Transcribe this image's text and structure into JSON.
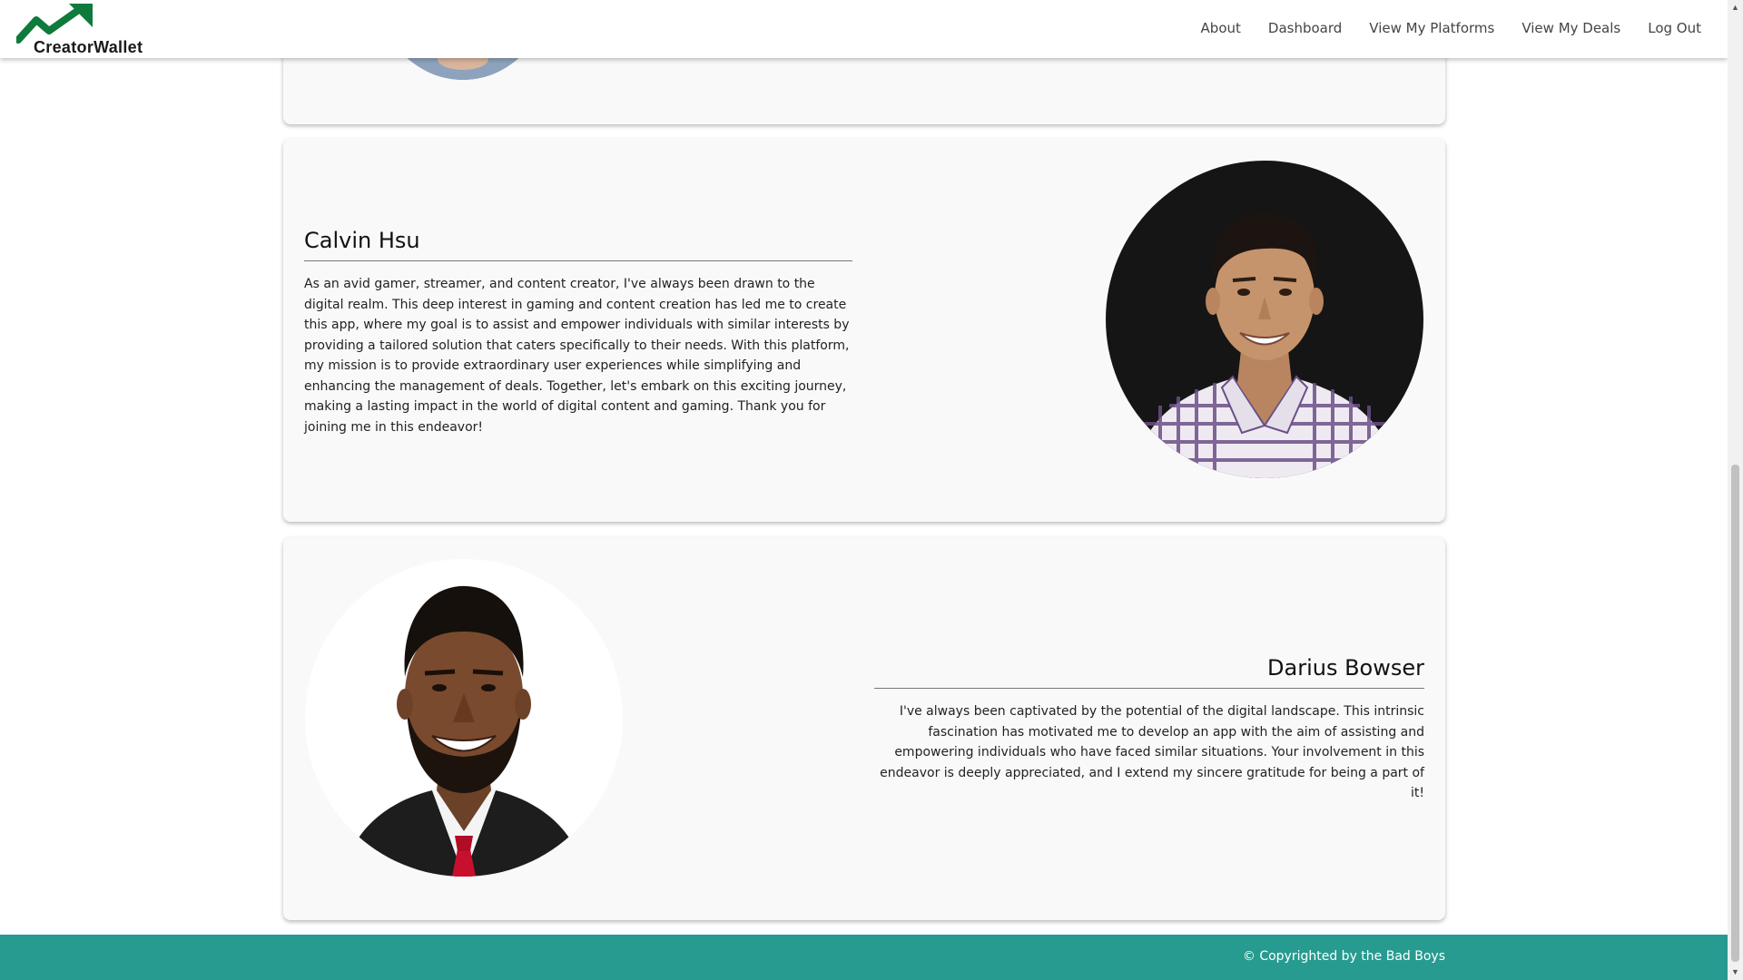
{
  "brand": {
    "name_part1": "Creator",
    "name_part2": "Wallet",
    "accent_color": "#0e7a3c"
  },
  "nav": {
    "items": [
      {
        "label": "About"
      },
      {
        "label": "Dashboard"
      },
      {
        "label": "View My Platforms"
      },
      {
        "label": "View My Deals"
      },
      {
        "label": "Log Out"
      }
    ]
  },
  "team": [
    {
      "name": "Calvin Hsu",
      "bio": "As an avid gamer, streamer, and content creator, I've always been drawn to the digital realm. This deep interest in gaming and content creation has led me to create this app, where my goal is to assist and empower individuals with similar interests by providing a tailored solution that caters specifically to their needs. With this platform, my mission is to provide extraordinary user experiences while simplifying and enhancing the management of deals. Together, let's embark on this exciting journey, making a lasting impact in the world of digital content and gaming. Thank you for joining me in this endeavor!"
    },
    {
      "name": "Darius Bowser",
      "bio": "I've always been captivated by the potential of the digital landscape. This intrinsic fascination has motivated me to develop an app with the aim of assisting and empowering individuals who have faced similar situations. Your involvement in this endeavor is deeply appreciated, and I extend my sincere gratitude for being a part of it!"
    }
  ],
  "footer": {
    "text": "© Copyrighted by the Bad Boys",
    "color": "#279b8f"
  }
}
